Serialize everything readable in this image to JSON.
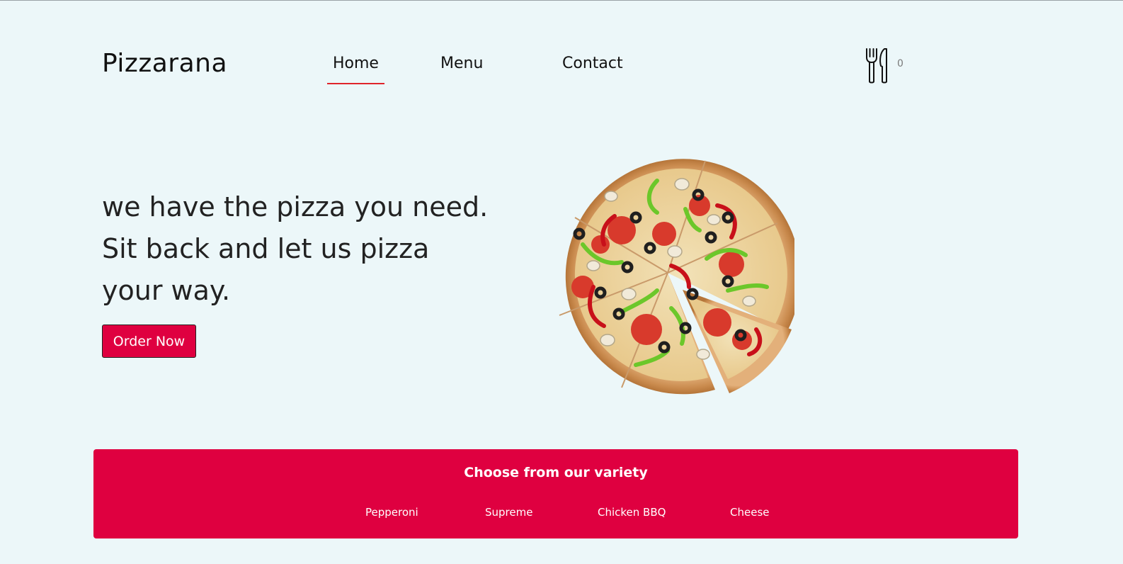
{
  "brand": {
    "name": "Pizzarana"
  },
  "nav": {
    "items": [
      {
        "label": "Home",
        "active": true
      },
      {
        "label": "Menu",
        "active": false
      },
      {
        "label": "Contact",
        "active": false
      }
    ],
    "active_underline_color": "#e0242b"
  },
  "cart": {
    "icon": "fork-knife-icon",
    "count": "0"
  },
  "hero": {
    "lines": [
      "we have the pizza you need.",
      "Sit back and let us pizza",
      "your way."
    ],
    "cta_label": "Order Now",
    "image": "pizza-image"
  },
  "variety": {
    "title": "Choose from our variety",
    "items": [
      "Pepperoni",
      "Supreme",
      "Chicken BBQ",
      "Cheese"
    ]
  },
  "colors": {
    "background": "#ecf7f9",
    "accent": "#df0040",
    "text": "#222222"
  }
}
